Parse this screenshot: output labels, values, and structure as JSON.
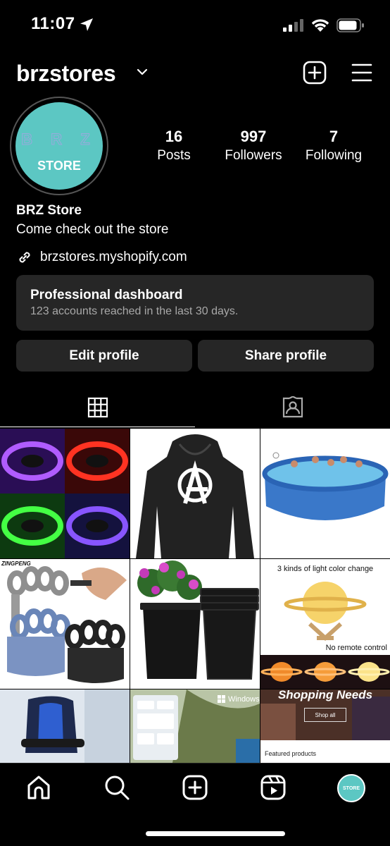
{
  "status_bar": {
    "time": "11:07"
  },
  "header": {
    "username": "brzstores"
  },
  "profile": {
    "avatar_text_top": "B R Z",
    "avatar_text_bottom": "STORE",
    "stats": [
      {
        "value": "16",
        "label": "Posts"
      },
      {
        "value": "997",
        "label": "Followers"
      },
      {
        "value": "7",
        "label": "Following"
      }
    ],
    "name": "BRZ Store",
    "bio": "Come check out the store",
    "link": "brzstores.myshopify.com"
  },
  "dashboard": {
    "title": "Professional dashboard",
    "subtitle": "123 accounts reached in the last 30 days."
  },
  "actions": {
    "edit": "Edit profile",
    "share": "Share profile"
  },
  "grid": {
    "posts": [
      {
        "kind": "led-strips"
      },
      {
        "kind": "anarchy-hoodie"
      },
      {
        "kind": "pool"
      },
      {
        "kind": "hand-grips",
        "caption": "ZINGPENG"
      },
      {
        "kind": "flower-pots"
      },
      {
        "kind": "moon-lamp",
        "caption_top": "3 kinds of light color change",
        "caption_bottom": "No remote control"
      },
      {
        "kind": "gaming-chair"
      },
      {
        "kind": "windows-screenshot",
        "caption": "Windows 1"
      },
      {
        "kind": "shop-banner",
        "caption_top": "Shopping Needs",
        "button": "Shop all",
        "footer": "Featured products"
      }
    ]
  },
  "nav": {
    "items": [
      "home-icon",
      "search-icon",
      "new-post-icon",
      "reels-icon",
      "profile-avatar"
    ],
    "avatar_text": "STORE"
  },
  "colors": {
    "accent": "#5cc7c3",
    "panel": "#262626",
    "muted": "#a8a8a8"
  }
}
